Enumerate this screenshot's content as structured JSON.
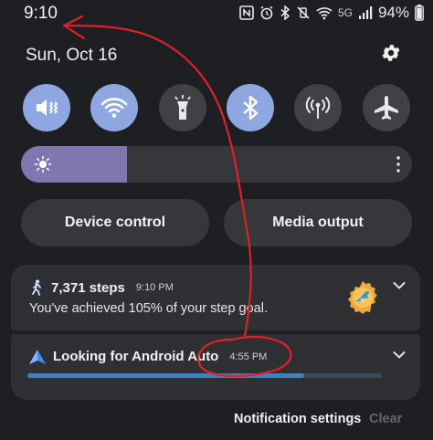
{
  "status_bar": {
    "time": "9:10",
    "network": "5G",
    "battery": "94%"
  },
  "header": {
    "date": "Sun, Oct 16"
  },
  "quick_settings": {
    "toggles": [
      {
        "icon": "mute-vibrate-icon",
        "state": "on"
      },
      {
        "icon": "wifi-icon",
        "state": "on"
      },
      {
        "icon": "flashlight-icon",
        "state": "off"
      },
      {
        "icon": "bluetooth-icon",
        "state": "on"
      },
      {
        "icon": "mobile-hotspot-icon",
        "state": "off"
      },
      {
        "icon": "airplane-mode-icon",
        "state": "off"
      }
    ],
    "brightness_level": 0.27,
    "device_control_label": "Device control",
    "media_output_label": "Media output"
  },
  "notifications": [
    {
      "title": "7,371 steps",
      "time": "9:10 PM",
      "body": "You've achieved 105% of your step goal.",
      "icon": "walking-person-icon"
    },
    {
      "title": "Looking for Android Auto",
      "time": "4:55 PM",
      "icon": "android-auto-icon",
      "progress": 0.78
    }
  ],
  "footer": {
    "notification_settings_label": "Notification settings",
    "clear_label": "Clear"
  },
  "colors": {
    "background": "#1e1f23",
    "toggle_on": "#8fa7e0",
    "toggle_off": "#3f4145",
    "brightness_fill": "#8077b0",
    "progress": "#3f7fc6",
    "annotation": "#e0202a"
  }
}
